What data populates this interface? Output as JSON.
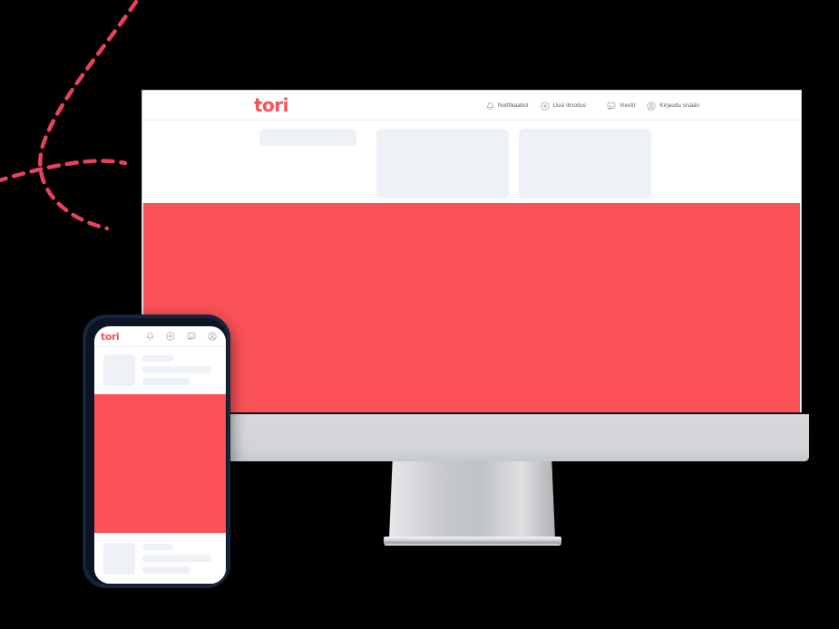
{
  "brand": {
    "name": "tori",
    "accent_color": "#fb5257",
    "logo_color": "#fa5255",
    "skeleton_color": "#eef1f6"
  },
  "decoration": {
    "curve_color": "#e8415a",
    "style": "dashed-curves"
  },
  "desktop": {
    "device": "imac-style-monitor",
    "header": {
      "logo": "tori",
      "nav": [
        {
          "icon": "bell-icon",
          "label": "Notifikaatiot"
        },
        {
          "icon": "plus-circle-icon",
          "label": "Uusi ilmoitus"
        },
        {
          "icon": "chat-bubble-icon",
          "label": "Viestit"
        },
        {
          "icon": "user-circle-icon",
          "label": "Kirjaudu sisään"
        }
      ]
    },
    "skeleton": {
      "pill": "placeholder-pill",
      "card_1": "placeholder-card",
      "card_2": "placeholder-card"
    },
    "hero": {
      "type": "red-banner"
    }
  },
  "phone": {
    "device": "smartphone-mockup",
    "header": {
      "logo": "tori",
      "icons": [
        "bell-icon",
        "plus-circle-icon",
        "chat-bubble-icon",
        "user-circle-icon"
      ]
    },
    "top_listing": {
      "thumb": "placeholder-thumb",
      "lines": 3
    },
    "hero": {
      "type": "red-banner"
    },
    "bottom_listing": {
      "thumb": "placeholder-thumb",
      "lines": 3
    }
  }
}
